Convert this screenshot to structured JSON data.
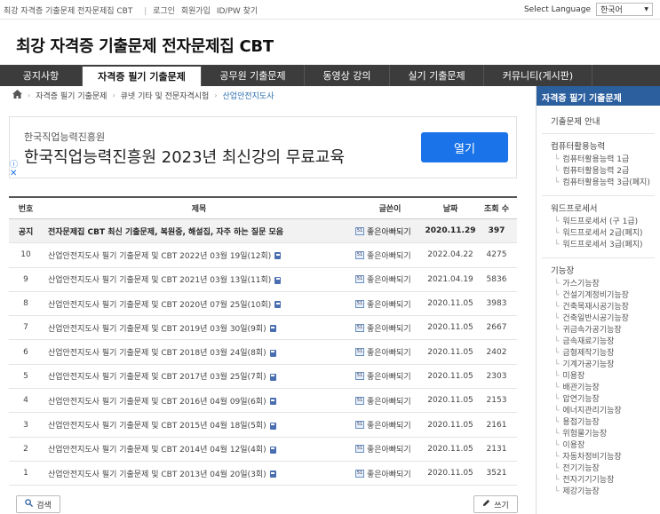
{
  "topbar": {
    "site_name": "최강 자격증 기출문제 전자문제집 CBT",
    "login": "로그인",
    "signup": "회원가입",
    "find_id": "ID/PW 찾기",
    "lang_label": "Select Language",
    "lang_value": "한국어"
  },
  "header": {
    "title": "최강 자격증 기출문제 전자문제집 CBT"
  },
  "nav": [
    "공지사항",
    "자격증 필기 기출문제",
    "공무원 기출문제",
    "동영상 강의",
    "실기 기출문제",
    "커뮤니티(게시판)"
  ],
  "breadcrumb": [
    "자격증 필기 기출문제",
    "큐넷 기타 및 전문자격시험",
    "산업안전지도사"
  ],
  "ad": {
    "small": "한국직업능력진흥원",
    "big": "한국직업능력진흥원 2023년 최신강의 무료교육",
    "button": "열기"
  },
  "table": {
    "headers": [
      "번호",
      "제목",
      "글쓴이",
      "날짜",
      "조회 수"
    ],
    "rows": [
      {
        "num": "공지",
        "title": "전자문제집 CBT 최신 기출문제, 복원중, 해설집, 자주 하는 질문 모음",
        "author": "좋은아빠되기",
        "date": "2020.11.29",
        "views": "397",
        "notice": true
      },
      {
        "num": "10",
        "title": "산업안전지도사 필기 기출문제 및 CBT 2022년 03월 19일(12회)",
        "author": "좋은아빠되기",
        "date": "2022.04.22",
        "views": "4275"
      },
      {
        "num": "9",
        "title": "산업안전지도사 필기 기출문제 및 CBT 2021년 03월 13일(11회)",
        "author": "좋은아빠되기",
        "date": "2021.04.19",
        "views": "5836"
      },
      {
        "num": "8",
        "title": "산업안전지도사 필기 기출문제 및 CBT 2020년 07월 25일(10회)",
        "author": "좋은아빠되기",
        "date": "2020.11.05",
        "views": "3983"
      },
      {
        "num": "7",
        "title": "산업안전지도사 필기 기출문제 및 CBT 2019년 03월 30일(9회)",
        "author": "좋은아빠되기",
        "date": "2020.11.05",
        "views": "2667"
      },
      {
        "num": "6",
        "title": "산업안전지도사 필기 기출문제 및 CBT 2018년 03월 24일(8회)",
        "author": "좋은아빠되기",
        "date": "2020.11.05",
        "views": "2402"
      },
      {
        "num": "5",
        "title": "산업안전지도사 필기 기출문제 및 CBT 2017년 03월 25일(7회)",
        "author": "좋은아빠되기",
        "date": "2020.11.05",
        "views": "2303"
      },
      {
        "num": "4",
        "title": "산업안전지도사 필기 기출문제 및 CBT 2016년 04월 09일(6회)",
        "author": "좋은아빠되기",
        "date": "2020.11.05",
        "views": "2153"
      },
      {
        "num": "3",
        "title": "산업안전지도사 필기 기출문제 및 CBT 2015년 04월 18일(5회)",
        "author": "좋은아빠되기",
        "date": "2020.11.05",
        "views": "2161"
      },
      {
        "num": "2",
        "title": "산업안전지도사 필기 기출문제 및 CBT 2014년 04월 12일(4회)",
        "author": "좋은아빠되기",
        "date": "2020.11.05",
        "views": "2131"
      },
      {
        "num": "1",
        "title": "산업안전지도사 필기 기출문제 및 CBT 2013년 04월 20일(3회)",
        "author": "좋은아빠되기",
        "date": "2020.11.05",
        "views": "3521"
      }
    ]
  },
  "buttons": {
    "search": "검색",
    "write": "쓰기"
  },
  "sidebar": {
    "header": "자격증 필기 기출문제",
    "guide": "기출문제 안내",
    "groups": [
      {
        "title": "컴퓨터활용능력",
        "items": [
          "컴퓨터활용능력 1급",
          "컴퓨터활용능력 2급",
          "컴퓨터활용능력 3급(폐지)"
        ]
      },
      {
        "title": "워드프로세서",
        "items": [
          "워드프로세서 (구 1급)",
          "워드프로세서 2급(폐지)",
          "워드프로세서 3급(폐지)"
        ]
      },
      {
        "title": "기능장",
        "items": [
          "가스기능장",
          "건설기계정비기능장",
          "건축목재시공기능장",
          "건축일반시공기능장",
          "귀금속가공기능장",
          "금속재료기능장",
          "금형제작기능장",
          "기계가공기능장",
          "미용장",
          "배관기능장",
          "압연기능장",
          "에너지관리기능장",
          "용접기능장",
          "위험물기능장",
          "이용장",
          "자동차정비기능장",
          "전기기능장",
          "전자기기기능장",
          "제강기능장"
        ]
      }
    ]
  }
}
